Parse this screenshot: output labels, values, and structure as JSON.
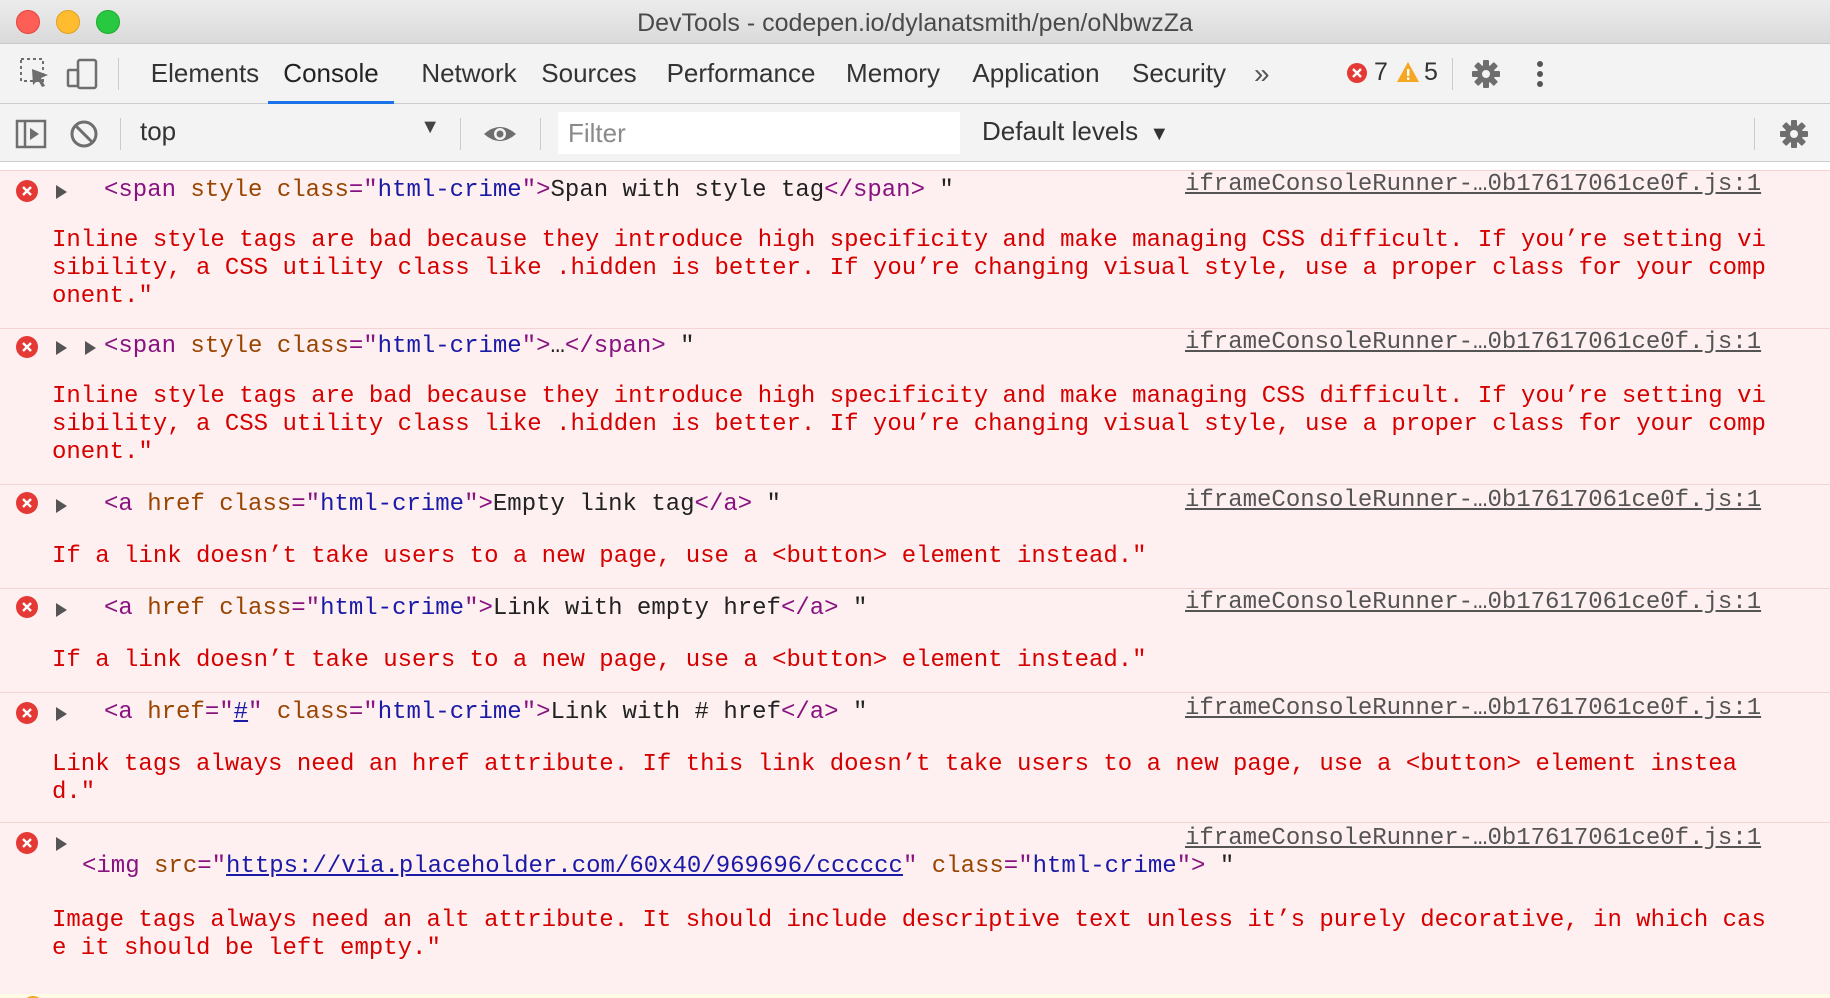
{
  "window": {
    "title": "DevTools - codepen.io/dylanatsmith/pen/oNbwzZa"
  },
  "tabs": [
    {
      "label": "Elements"
    },
    {
      "label": "Console"
    },
    {
      "label": "Network"
    },
    {
      "label": "Sources"
    },
    {
      "label": "Performance"
    },
    {
      "label": "Memory"
    },
    {
      "label": "Application"
    },
    {
      "label": "Security"
    }
  ],
  "status": {
    "errors": "7",
    "warnings": "5"
  },
  "console_toolbar": {
    "context": "top",
    "filter_placeholder": "Filter",
    "levels": "Default levels"
  },
  "messages": [
    {
      "code": {
        "tag_open": "<span",
        "attr1": "style",
        "attr2": "class",
        "eq": "=",
        "q": "\"",
        "class_val": "html-crime",
        "close_bracket": ">",
        "content": "Span with style tag",
        "tag_close": "</span>",
        "trailing": " \""
      },
      "source": "iframeConsoleRunner-…0b17617061ce0f.js:1",
      "text": "Inline style tags are bad because they introduce high specificity and make managing CSS difficult. If you’re setting visibility, a CSS utility class like .hidden is better. If you’re changing visual style, use a proper class for your component.\""
    },
    {
      "code": {
        "tag_open": "<span",
        "attr1": "style",
        "attr2": "class",
        "eq": "=",
        "q": "\"",
        "class_val": "html-crime",
        "close_bracket": ">",
        "content": "…",
        "tag_close": "</span>",
        "trailing": " \""
      },
      "source": "iframeConsoleRunner-…0b17617061ce0f.js:1",
      "text": "Inline style tags are bad because they introduce high specificity and make managing CSS difficult. If you’re setting visibility, a CSS utility class like .hidden is better. If you’re changing visual style, use a proper class for your component.\""
    },
    {
      "code": {
        "tag_open": "<a",
        "attr1": "href",
        "attr2": "class",
        "eq": "=",
        "q": "\"",
        "class_val": "html-crime",
        "close_bracket": ">",
        "content": "Empty link tag",
        "tag_close": "</a>",
        "trailing": " \""
      },
      "source": "iframeConsoleRunner-…0b17617061ce0f.js:1",
      "text": "If a link doesn’t take users to a new page, use a <button> element instead.\""
    },
    {
      "code": {
        "tag_open": "<a",
        "attr1": "href",
        "attr2": "class",
        "eq": "=",
        "q": "\"",
        "class_val": "html-crime",
        "close_bracket": ">",
        "content": "Link with empty href",
        "tag_close": "</a>",
        "trailing": " \""
      },
      "source": "iframeConsoleRunner-…0b17617061ce0f.js:1",
      "text": "If a link doesn’t take users to a new page, use a <button> element instead.\""
    },
    {
      "code": {
        "tag_open": "<a",
        "attr1": "href",
        "href_val": "#",
        "attr2": "class",
        "eq": "=",
        "q": "\"",
        "class_val": "html-crime",
        "close_bracket": ">",
        "content": "Link with # href",
        "tag_close": "</a>",
        "trailing": " \""
      },
      "source": "iframeConsoleRunner-…0b17617061ce0f.js:1",
      "text": "Link tags always need an href attribute. If this link doesn’t take users to a new page, use a <button> element instead.\""
    },
    {
      "code": {
        "tag_open": "<img",
        "attr1": "src",
        "src_val": "https://via.placeholder.com/60x40/969696/cccccc",
        "attr2": "class",
        "eq": "=",
        "q": "\"",
        "class_val": "html-crime",
        "close_bracket": ">",
        "trailing": " \""
      },
      "source": "iframeConsoleRunner-…0b17617061ce0f.js:1",
      "text": "Image tags always need an alt attribute. It should include descriptive text unless it’s purely decorative, in which case it should be left empty.\""
    }
  ]
}
